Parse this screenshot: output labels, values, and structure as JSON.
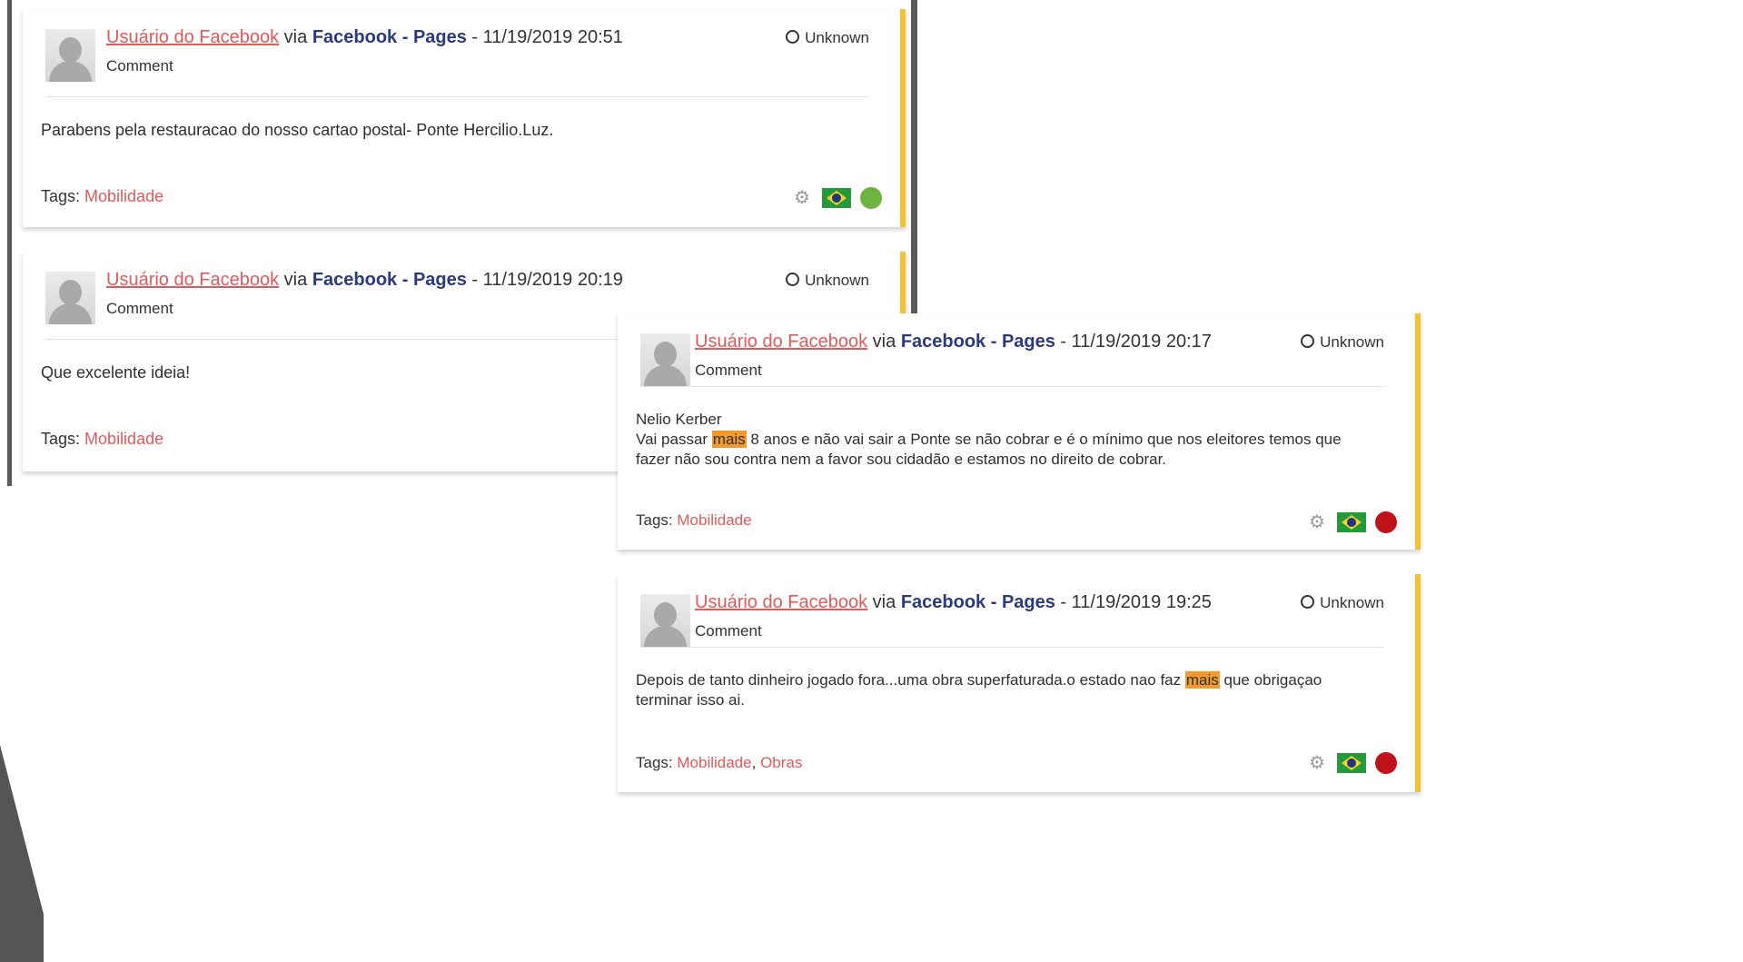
{
  "comments": [
    {
      "author": "Usuário do Facebook",
      "via": "via",
      "source": "Facebook - Pages",
      "datetime": " - 11/19/2019 20:51",
      "type": "Comment",
      "status": "Unknown",
      "body_lines": [
        "Parabens pela restauracao do nosso cartao postal-  Ponte Hercilio.Luz."
      ],
      "highlight": "",
      "tags_label": "Tags:",
      "tags": [
        "Mobilidade"
      ],
      "sentiment_color": "#6cb33f",
      "gear_icon": "gear-icon",
      "flag_icon": "brazil-flag-icon"
    },
    {
      "author": "Usuário do Facebook",
      "via": "via",
      "source": "Facebook - Pages",
      "datetime": " - 11/19/2019 20:19",
      "type": "Comment",
      "status": "Unknown",
      "body_lines": [
        "Que excelente ideia!"
      ],
      "highlight": "",
      "tags_label": "Tags:",
      "tags": [
        "Mobilidade"
      ],
      "sentiment_color": ""
    },
    {
      "author": "Usuário do Facebook",
      "via": "via",
      "source": "Facebook - Pages",
      "datetime": " - 11/19/2019 20:17",
      "type": "Comment",
      "status": "Unknown",
      "body_name": "Nelio Kerber",
      "body_parts": [
        {
          "text": "Vai passar "
        },
        {
          "text": "mais",
          "hl": true
        },
        {
          "text": " 8 anos e não vai sair a Ponte se não cobrar e é o mínimo que nos eleitores temos que fazer não sou contra nem a favor sou cidadão e estamos no direito de cobrar."
        }
      ],
      "tags_label": "Tags:",
      "tags": [
        "Mobilidade"
      ],
      "sentiment_color": "#c0121a"
    },
    {
      "author": "Usuário do Facebook",
      "via": "via",
      "source": "Facebook - Pages",
      "datetime": " - 11/19/2019 19:25",
      "type": "Comment",
      "status": "Unknown",
      "body_parts": [
        {
          "text": "Depois de tanto dinheiro jogado fora...uma obra superfaturada.o estado nao faz "
        },
        {
          "text": "mais",
          "hl": true
        },
        {
          "text": " que obrigaçao terminar isso ai."
        }
      ],
      "tags_label": "Tags:",
      "tags": [
        "Mobilidade",
        "Obras"
      ],
      "sentiment_color": "#c0121a"
    }
  ]
}
